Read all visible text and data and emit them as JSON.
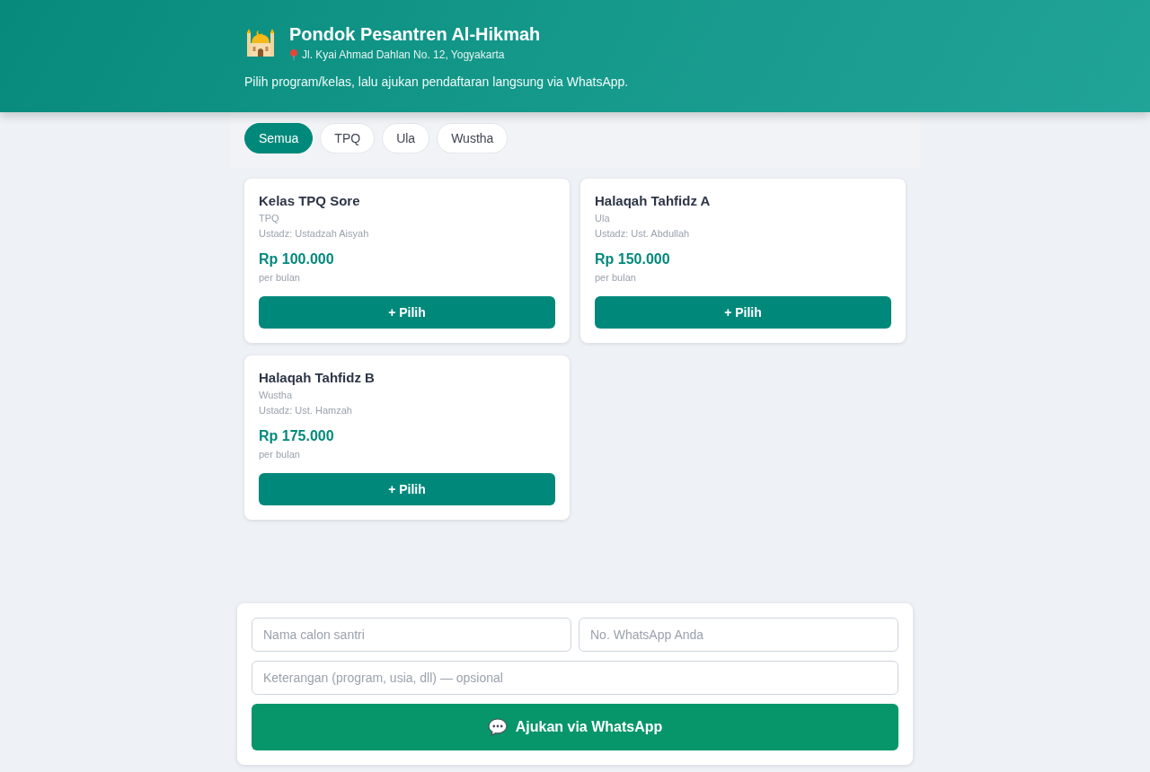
{
  "header": {
    "title": "Pondok Pesantren Al-Hikmah",
    "address": "Jl. Kyai Ahmad Dahlan No. 12, Yogyakarta",
    "tagline": "Pilih program/kelas, lalu ajukan pendaftaran langsung via WhatsApp."
  },
  "filters": [
    {
      "label": "Semua",
      "selected": true
    },
    {
      "label": "TPQ",
      "selected": false
    },
    {
      "label": "Ula",
      "selected": false
    },
    {
      "label": "Wustha",
      "selected": false
    }
  ],
  "classes": [
    {
      "name": "Kelas TPQ Sore",
      "category": "TPQ",
      "teacher": "Ustadz: Ustadzah Aisyah",
      "price": "Rp 100.000",
      "period": "per bulan",
      "button": "+ Pilih"
    },
    {
      "name": "Halaqah Tahfidz A",
      "category": "Ula",
      "teacher": "Ustadz: Ust. Abdullah",
      "price": "Rp 150.000",
      "period": "per bulan",
      "button": "+ Pilih"
    },
    {
      "name": "Halaqah Tahfidz B",
      "category": "Wustha",
      "teacher": "Ustadz: Ust. Hamzah",
      "price": "Rp 175.000",
      "period": "per bulan",
      "button": "+ Pilih"
    }
  ],
  "form": {
    "fields": [
      {
        "placeholder": "Nama calon santri"
      },
      {
        "placeholder": "No. WhatsApp Anda"
      },
      {
        "placeholder": "Keterangan (program, usia, dll) — opsional"
      }
    ],
    "submit": "Ajukan via WhatsApp"
  }
}
